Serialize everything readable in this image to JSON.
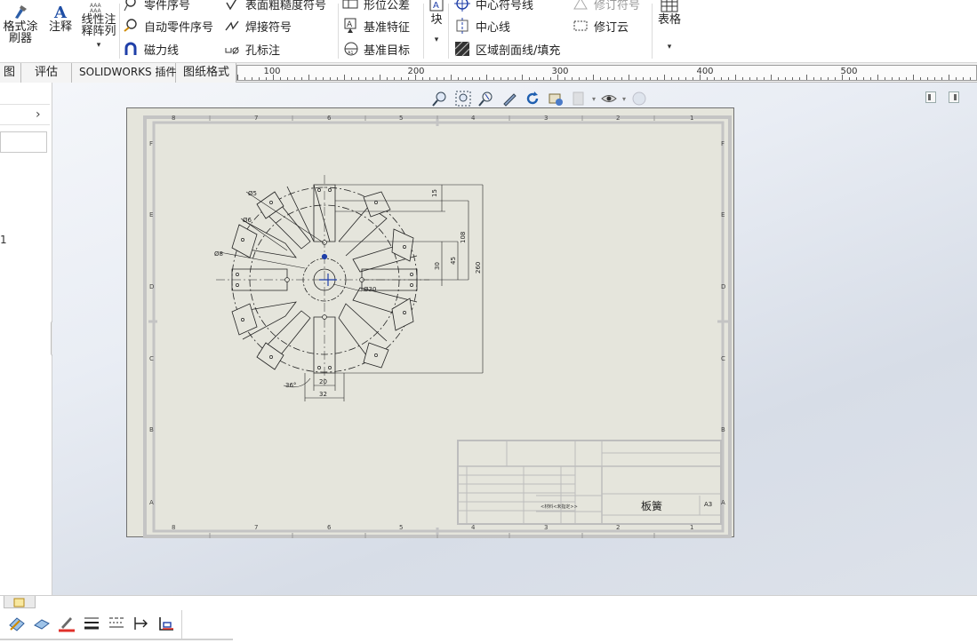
{
  "ribbon": {
    "format_painter": "格式涂\n刷器",
    "note": "注释",
    "linear_note_array": "线性注\n释阵列",
    "balloon": "零件序号",
    "auto_balloon": "自动零件序号",
    "magnetic_line": "磁力线",
    "surface_finish": "表面粗糙度符号",
    "weld_symbol": "焊接符号",
    "hole_callout": "孔标注",
    "geometric_tolerance": "形位公差",
    "datum_feature": "基准特征",
    "datum_target": "基准目标",
    "block": "块",
    "centermark": "中心符号线",
    "centerline": "中心线",
    "area_hatch": "区域剖面线/填充",
    "revision_symbol": "修订符号",
    "revision_cloud": "修订云",
    "table": "表格"
  },
  "tabs": [
    "图",
    "评估",
    "SOLIDWORKS 插件",
    "图纸格式"
  ],
  "ruler": {
    "labels": [
      "100",
      "200",
      "300",
      "400",
      "500"
    ]
  },
  "left_panel": {
    "fragment_text": "1"
  },
  "drawing": {
    "zone_numbers": [
      "8",
      "7",
      "6",
      "5",
      "4",
      "3",
      "2",
      "1"
    ],
    "zone_letters": [
      "F",
      "E",
      "D",
      "C",
      "B",
      "A"
    ],
    "title_block_part_name": "板簧",
    "title_block_size": "A3",
    "title_block_material": "<材料<未指定>>",
    "dims": {
      "d5": "Ø5",
      "d6": "Ø6",
      "d8": "Ø8",
      "d30": "Ø30",
      "v15": "15",
      "v108": "108",
      "v30": "30",
      "v45": "45",
      "v260": "260",
      "h20": "20",
      "h32": "32",
      "ang": "36°"
    }
  },
  "colors": {
    "sheet": "#e5e5dc",
    "border": "#c4c4c4",
    "accent": "#1f3fa8"
  }
}
